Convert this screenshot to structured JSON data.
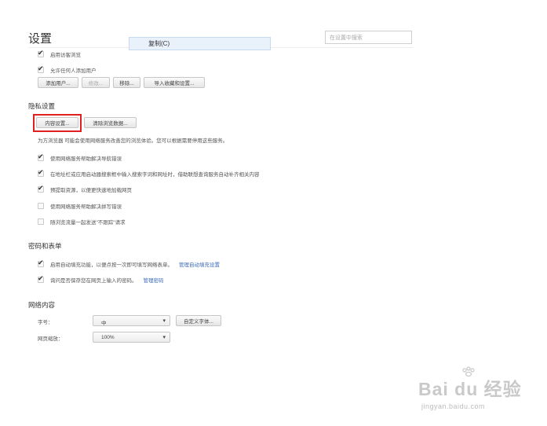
{
  "header": {
    "title": "设置",
    "search_placeholder": "在设置中搜索"
  },
  "context_menu": {
    "copy_label": "复制(C)"
  },
  "users": {
    "items": [
      {
        "label": "启用访客浏览",
        "checked": true
      },
      {
        "label": "允许任何人添加用户",
        "checked": true
      }
    ],
    "buttons": [
      "添加用户...",
      "修改...",
      "移除...",
      "导入收藏和设置..."
    ]
  },
  "privacy": {
    "heading": "隐私设置",
    "content_settings_button": "内容设置...",
    "clear_data_button": "清除浏览数据...",
    "description": "为方浏览器 可能会使用网络服务改善您的浏览体验。您可以根据需要停用这些服务。",
    "items": [
      {
        "label": "使用网络服务帮助解决导航错误",
        "checked": true
      },
      {
        "label": "在地址栏或应用启动器搜索框中输入搜索字词和网址时，借助联想查询服务自动补齐相关内容",
        "checked": true
      },
      {
        "label": "预提取资源，以便更快速地加载网页",
        "checked": true
      },
      {
        "label": "使用网络服务帮助解决拼写错误",
        "checked": false
      },
      {
        "label": "随浏览流量一起发送\"不跟踪\"请求",
        "checked": false
      }
    ]
  },
  "passwords": {
    "heading": "密码和表单",
    "items": [
      {
        "label": "启用自动填充功能，以便点按一次即可填写网络表单。",
        "link": "管理自动填充设置",
        "checked": true
      },
      {
        "label": "询问是否保存您在网页上输入的密码。",
        "link": "管理密码",
        "checked": true
      }
    ]
  },
  "web_content": {
    "heading": "网络内容",
    "font_size_label": "字号：",
    "font_size_value": "中",
    "customize_fonts_button": "自定义字体...",
    "zoom_label": "网页缩放：",
    "zoom_value": "100%"
  },
  "watermark": {
    "main": "Bai du 经验",
    "sub": "jingyan.baidu.com"
  }
}
